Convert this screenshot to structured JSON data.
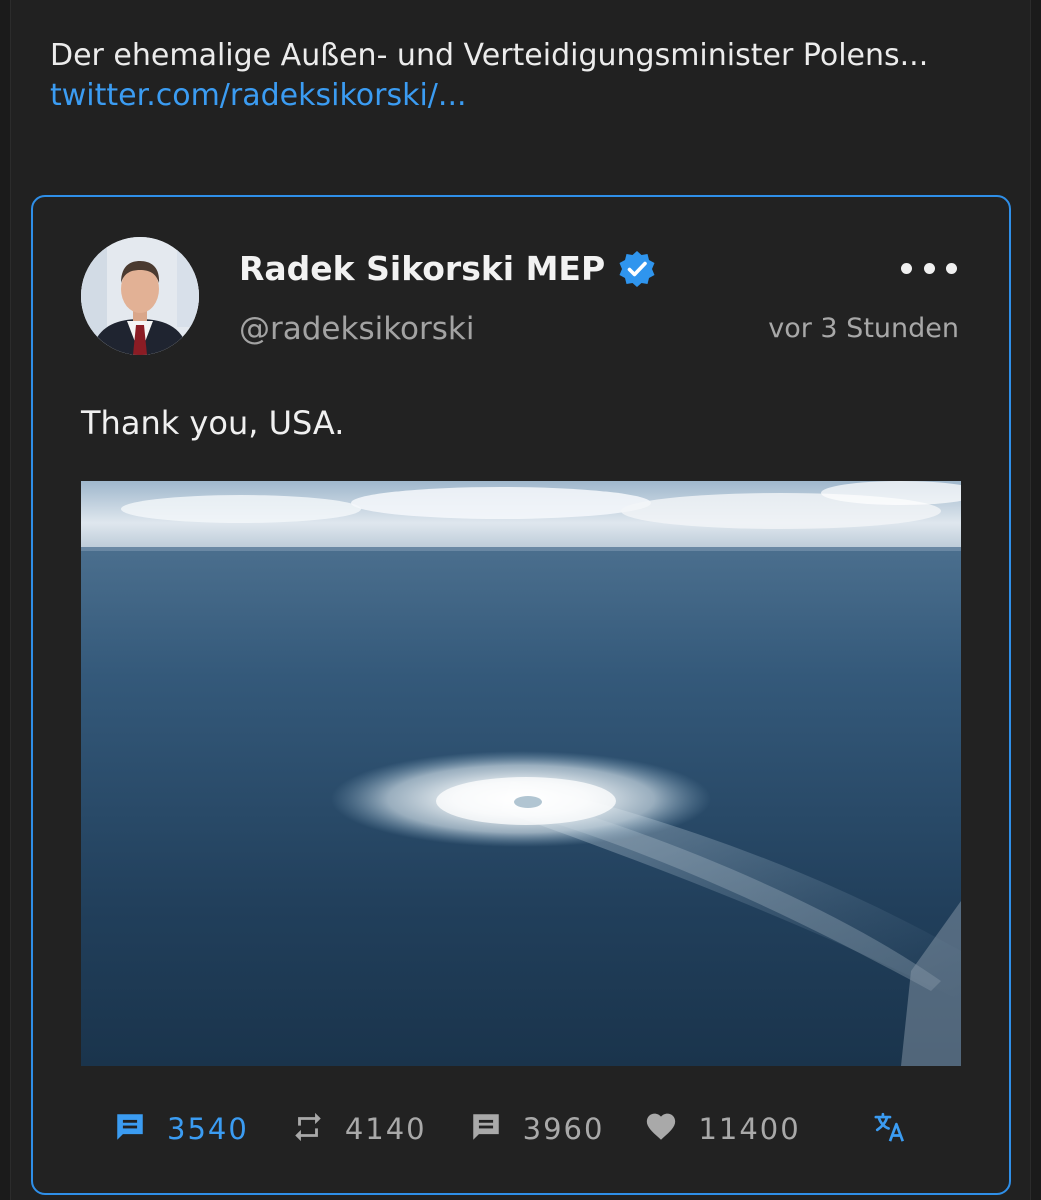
{
  "post": {
    "text": "Der ehemalige Außen- und Verteidigungsminister Polens...",
    "link": "twitter.com/radeksikorski/..."
  },
  "quoted_tweet": {
    "author_name": "Radek Sikorski MEP",
    "handle": "@radeksikorski",
    "timestamp": "vor 3 Stunden",
    "text": "Thank you, USA.",
    "image_description_icon": "photo",
    "stats": {
      "replies": "3540",
      "retweets": "4140",
      "quotes": "3960",
      "likes": "11400"
    }
  },
  "colors": {
    "accent": "#3b9cf2",
    "border": "#2f8fe8",
    "background": "#212121"
  },
  "icons": [
    "verified-icon",
    "more-icon",
    "reply-icon",
    "retweet-icon",
    "quote-icon",
    "like-icon",
    "translate-icon"
  ]
}
